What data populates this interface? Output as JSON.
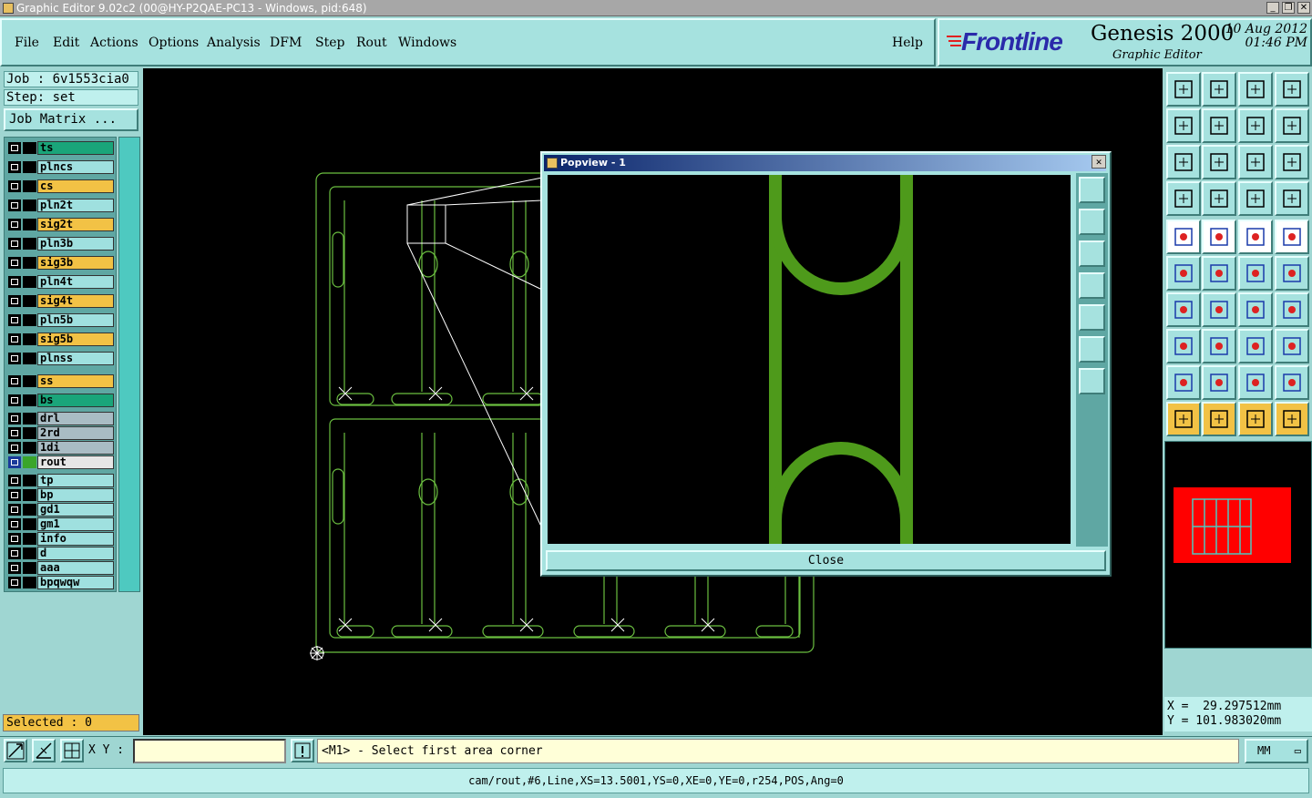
{
  "window": {
    "title": "Graphic Editor 9.02c2 (00@HY-P2QAE-PC13 - Windows, pid:648)"
  },
  "menu": {
    "items": [
      {
        "label": "File"
      },
      {
        "label": "Edit"
      },
      {
        "label": "Actions"
      },
      {
        "label": "Options"
      },
      {
        "label": "Analysis"
      },
      {
        "label": "DFM"
      },
      {
        "label": "Step"
      },
      {
        "label": "Rout"
      },
      {
        "label": "Windows"
      }
    ],
    "help": "Help"
  },
  "brand": {
    "logo": "Frontline",
    "product": "Genesis 2000",
    "subtitle": "Graphic Editor",
    "date": "10 Aug 2012",
    "time": "01:46 PM"
  },
  "job": {
    "job_label": "Job : 6v1553cia0",
    "step_label": "Step: set",
    "matrix_button": "Job Matrix ..."
  },
  "layers": [
    {
      "name": "ts",
      "color": "#1aa57a"
    },
    {
      "name": "plncs",
      "color": "#9fe0df"
    },
    {
      "name": "cs",
      "color": "#f2c245"
    },
    {
      "name": "pln2t",
      "color": "#9fe0df"
    },
    {
      "name": "sig2t",
      "color": "#f2c245"
    },
    {
      "name": "pln3b",
      "color": "#9fe0df"
    },
    {
      "name": "sig3b",
      "color": "#f2c245"
    },
    {
      "name": "pln4t",
      "color": "#9fe0df"
    },
    {
      "name": "sig4t",
      "color": "#f2c245"
    },
    {
      "name": "pln5b",
      "color": "#9fe0df"
    },
    {
      "name": "sig5b",
      "color": "#f2c245"
    },
    {
      "name": "plnss",
      "color": "#9fe0df"
    },
    {
      "name": "ss",
      "color": "#f2c245"
    },
    {
      "name": "bs",
      "color": "#1aa57a"
    },
    {
      "name": "drl",
      "color": "#a9bcc4"
    },
    {
      "name": "2rd",
      "color": "#a9bcc4"
    },
    {
      "name": "1di",
      "color": "#a9bcc4"
    },
    {
      "name": "rout",
      "color": "#e6e6e6",
      "active": true
    },
    {
      "name": "tp",
      "color": "#9fe0df"
    },
    {
      "name": "bp",
      "color": "#9fe0df"
    },
    {
      "name": "gd1",
      "color": "#9fe0df"
    },
    {
      "name": "gm1",
      "color": "#9fe0df"
    },
    {
      "name": "info",
      "color": "#9fe0df"
    },
    {
      "name": "d",
      "color": "#9fe0df"
    },
    {
      "name": "aaa",
      "color": "#9fe0df"
    },
    {
      "name": "bpqwqw",
      "color": "#9fe0df"
    }
  ],
  "selected": "Selected : 0",
  "popview": {
    "title": "Popview - 1",
    "close_label": "Close"
  },
  "coords": {
    "x": "X =  29.297512mm",
    "y": "Y = 101.983020mm"
  },
  "bottom": {
    "xy_label": "X Y :",
    "xy_value": "",
    "prompt": "<M1> - Select first area corner",
    "units": "MM"
  },
  "status": "cam/rout,#6,Line,XS=13.5001,YS=0,XE=0,YE=0,r254,POS,Ang=0",
  "colors": {
    "trace": "#4e9a1b",
    "outline": "#6bbf40",
    "panel_bg": "#9fd6d2",
    "highlight": "#f2c245"
  }
}
